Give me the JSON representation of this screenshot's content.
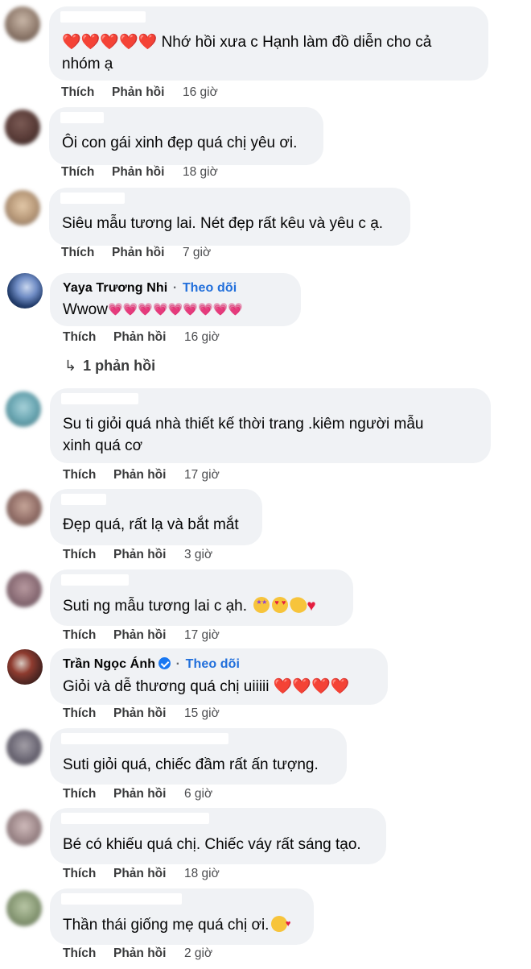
{
  "labels": {
    "like": "Thích",
    "reply": "Phản hồi",
    "follow": "Theo dõi",
    "separator": "·"
  },
  "comments": [
    {
      "text_lines": [
        "Nhớ hồi xưa c Hạnh làm đồ diễn cho cả",
        "nhóm ạ"
      ],
      "prefix_hearts": "❤️❤️❤️❤️❤️",
      "time": "16 giờ"
    },
    {
      "text_lines": [
        "Ôi con gái xinh đẹp quá chị yêu ơi."
      ],
      "time": "18 giờ"
    },
    {
      "text_lines": [
        "Siêu mẫu tương lai. Nét đẹp rất kêu và yêu c ạ."
      ],
      "time": "7 giờ"
    },
    {
      "author": "Yaya Trương Nhi",
      "text_lines": [
        "Wwow"
      ],
      "suffix_hearts": "💗💗💗💗💗💗💗💗💗",
      "time": "16 giờ",
      "replies_label": "1 phản hồi"
    },
    {
      "text_lines": [
        "Su ti giỏi quá nhà thiết kế thời trang .kiêm người mẫu",
        "xinh quá cơ"
      ],
      "time": "17 giờ"
    },
    {
      "text_lines": [
        "Đẹp quá, rất lạ và bắt mắt"
      ],
      "time": "3 giờ"
    },
    {
      "text_lines": [
        "Suti ng mẫu tương lai c ạh."
      ],
      "emoji": [
        "star-struck",
        "heart-eyes",
        "clapping-hands",
        "red-heart"
      ],
      "time": "17 giờ"
    },
    {
      "author": "Trần Ngọc Ánh",
      "verified": true,
      "text_lines": [
        "Giỏi và dễ thương quá chị uiiiii"
      ],
      "suffix_hearts": "❤️❤️❤️❤️",
      "time": "15 giờ"
    },
    {
      "text_lines": [
        "Suti giỏi quá, chiếc đầm rất ấn tượng."
      ],
      "time": "6 giờ"
    },
    {
      "text_lines": [
        "Bé có khiếu quá chị. Chiếc váy rất sáng tạo."
      ],
      "time": "18 giờ"
    },
    {
      "text_lines": [
        "Thần thái giống mẹ quá chị ơi."
      ],
      "emoji": [
        "smiling-face-with-hearts"
      ],
      "time": "2 giờ"
    }
  ],
  "colors": {
    "bubble": "#f0f2f5",
    "link_blue": "#216fdb",
    "heart_red": "#e41e3f",
    "heart_pink": "#f25268"
  }
}
